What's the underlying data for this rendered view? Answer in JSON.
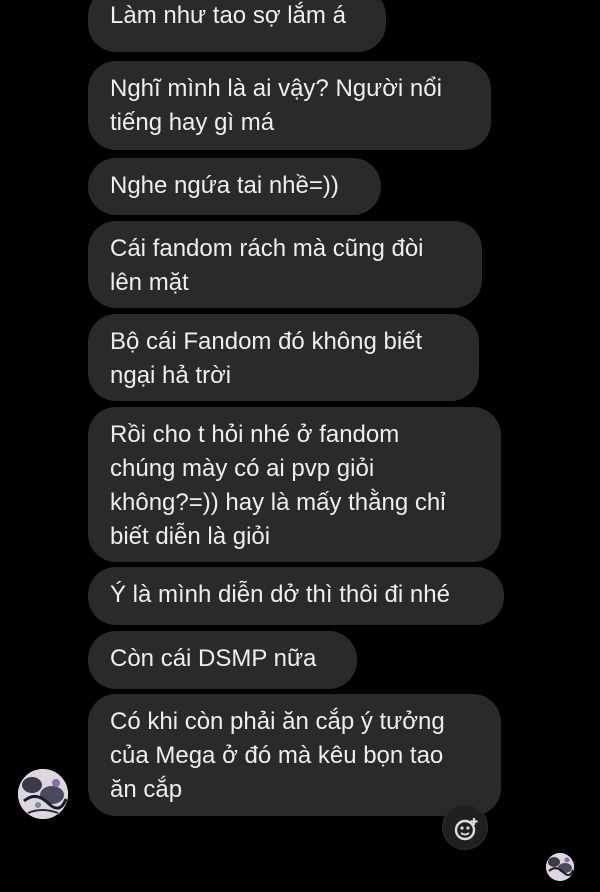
{
  "conversation": {
    "messages": [
      {
        "text": "Làm như tao sợ lắm á"
      },
      {
        "text": "Nghĩ mình là ai vậy? Người nổi\ntiếng hay gì má"
      },
      {
        "text": "Nghe ngứa tai nhề=))"
      },
      {
        "text": "Cái fandom rách mà cũng đòi\nlên mặt"
      },
      {
        "text": "Bộ cái Fandom đó không biết\nngại hả trời"
      },
      {
        "text": "Rồi cho t hỏi nhé ở fandom\nchúng mày có ai pvp giỏi\nkhông?=)) hay là mấy thằng chỉ\nbiết diễn là giỏi"
      },
      {
        "text": "Ý là mình diễn dở thì thôi đi nhé"
      },
      {
        "text": "Còn cái DSMP nữa"
      },
      {
        "text": "Có khi còn phải ăn cắp ý tưởng\ncủa Mega ở đó mà kêu bọn tao\năn cắp"
      }
    ]
  },
  "icons": {
    "sender_avatar": "sender-avatar",
    "react_button": "add-reaction-icon",
    "seen_avatar": "seen-avatar"
  },
  "colors": {
    "background": "#000000",
    "bubble": "#2a2a2c",
    "text": "#eeeeee"
  }
}
